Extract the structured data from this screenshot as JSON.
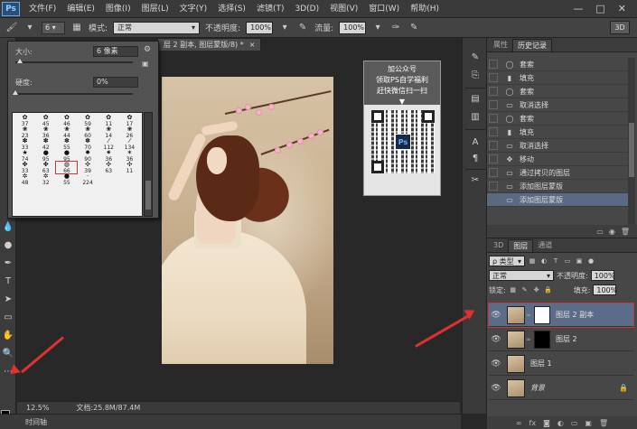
{
  "menubar": {
    "logo": "Ps",
    "items": [
      "文件(F)",
      "编辑(E)",
      "图像(I)",
      "图层(L)",
      "文字(Y)",
      "选择(S)",
      "滤镜(T)",
      "3D(D)",
      "视图(V)",
      "窗口(W)",
      "帮助(H)"
    ],
    "window_controls": [
      "—",
      "□",
      "✕"
    ]
  },
  "options": {
    "brush_size": "6",
    "mode_label": "模式:",
    "mode_value": "正常",
    "opacity_label": "不透明度:",
    "opacity_value": "100%",
    "flow_label": "流量:",
    "flow_value": "100%",
    "badge_3d": "3D"
  },
  "brush_picker": {
    "size_label": "大小:",
    "size_value": "6 像素",
    "hardness_label": "硬度:",
    "hardness_value": "0%",
    "presets": [
      {
        "n": "37",
        "g": "✿"
      },
      {
        "n": "45",
        "g": "✿"
      },
      {
        "n": "46",
        "g": "✿"
      },
      {
        "n": "59",
        "g": "✿"
      },
      {
        "n": "11",
        "g": "✿"
      },
      {
        "n": "17",
        "g": "✿"
      },
      {
        "n": "23",
        "g": "❀"
      },
      {
        "n": "36",
        "g": "❀"
      },
      {
        "n": "44",
        "g": "❀"
      },
      {
        "n": "60",
        "g": "❀"
      },
      {
        "n": "14",
        "g": "❀"
      },
      {
        "n": "26",
        "g": "❀"
      },
      {
        "n": "33",
        "g": "✽"
      },
      {
        "n": "42",
        "g": "✽"
      },
      {
        "n": "55",
        "g": "✽"
      },
      {
        "n": "70",
        "g": "✽"
      },
      {
        "n": "112",
        "g": "⁄"
      },
      {
        "n": "134",
        "g": "⁄"
      },
      {
        "n": "74",
        "g": "★"
      },
      {
        "n": "95",
        "g": "●"
      },
      {
        "n": "95",
        "g": "●"
      },
      {
        "n": "90",
        "g": "✸"
      },
      {
        "n": "36",
        "g": "✷"
      },
      {
        "n": "36",
        "g": "✶"
      },
      {
        "n": "33",
        "g": "✤"
      },
      {
        "n": "63",
        "g": "✤"
      },
      {
        "n": "66",
        "g": "◍"
      },
      {
        "n": "39",
        "g": "✣"
      },
      {
        "n": "63",
        "g": "✣"
      },
      {
        "n": "11",
        "g": "✣"
      },
      {
        "n": "48",
        "g": "✲"
      },
      {
        "n": "32",
        "g": "✲"
      },
      {
        "n": "55",
        "g": "●"
      },
      {
        "n": "224",
        "g": "·"
      },
      {
        "n": "",
        "g": ""
      },
      {
        "n": "",
        "g": ""
      }
    ],
    "selected_index": 26
  },
  "document": {
    "tab_title": "层 2 副本, 图层蒙版/8) *",
    "tab_close": "×",
    "zoom": "12.5%",
    "doc_size": "文档:25.8M/87.4M",
    "qr_card": {
      "line1": "加公众号",
      "line2": "领取PS自学福利",
      "line3": "赶快微信扫一扫",
      "arrow": "▼",
      "logo": "Ps"
    }
  },
  "history": {
    "tabs": [
      "属性",
      "历史记录"
    ],
    "active_tab": 1,
    "rows": [
      {
        "icon": "◯",
        "label": "套索"
      },
      {
        "icon": "▮",
        "label": "填充"
      },
      {
        "icon": "◯",
        "label": "套索"
      },
      {
        "icon": "▭",
        "label": "取消选择"
      },
      {
        "icon": "◯",
        "label": "套索"
      },
      {
        "icon": "▮",
        "label": "填充"
      },
      {
        "icon": "▭",
        "label": "取消选择"
      },
      {
        "icon": "✥",
        "label": "移动"
      },
      {
        "icon": "▭",
        "label": "通过拷贝的图层"
      },
      {
        "icon": "▭",
        "label": "添加图层蒙版"
      },
      {
        "icon": "▭",
        "label": "添加图层蒙版"
      }
    ],
    "selected_row": 10
  },
  "layers": {
    "tabs": [
      "3D",
      "图层",
      "通道"
    ],
    "active_tab": 1,
    "kind_label": "ρ 类型",
    "blend_mode": "正常",
    "opacity_label": "不透明度:",
    "opacity_value": "100%",
    "lock_label": "锁定:",
    "fill_label": "填充:",
    "fill_value": "100%",
    "items": [
      {
        "name": "图层 2 副本",
        "mask": "white",
        "selected": true
      },
      {
        "name": "图层 2",
        "mask": "black",
        "selected": false
      },
      {
        "name": "图层 1",
        "mask": "none",
        "selected": false
      },
      {
        "name": "背景",
        "mask": "none",
        "selected": false,
        "locked": true
      }
    ]
  },
  "timeline": {
    "label": "时间轴"
  },
  "colors": {
    "selection": "#5b6c88",
    "annotation_red": "#e03030"
  }
}
